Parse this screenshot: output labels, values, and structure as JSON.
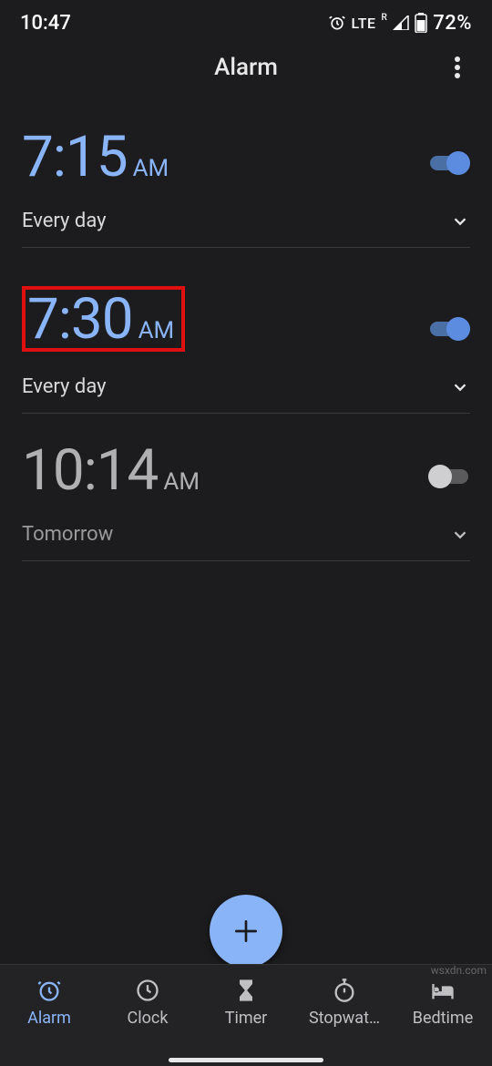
{
  "status": {
    "time": "10:47",
    "network": "LTE",
    "roaming": "R",
    "battery_pct": "72%"
  },
  "app": {
    "title": "Alarm"
  },
  "alarms": [
    {
      "time": "7:15",
      "ampm": "AM",
      "schedule": "Every day",
      "enabled": true,
      "highlighted": false
    },
    {
      "time": "7:30",
      "ampm": "AM",
      "schedule": "Every day",
      "enabled": true,
      "highlighted": true
    },
    {
      "time": "10:14",
      "ampm": "AM",
      "schedule": "Tomorrow",
      "enabled": false,
      "highlighted": false
    }
  ],
  "nav": [
    "Alarm",
    "Clock",
    "Timer",
    "Stopwat…",
    "Bedtime"
  ],
  "watermark": "wsxdn.com"
}
